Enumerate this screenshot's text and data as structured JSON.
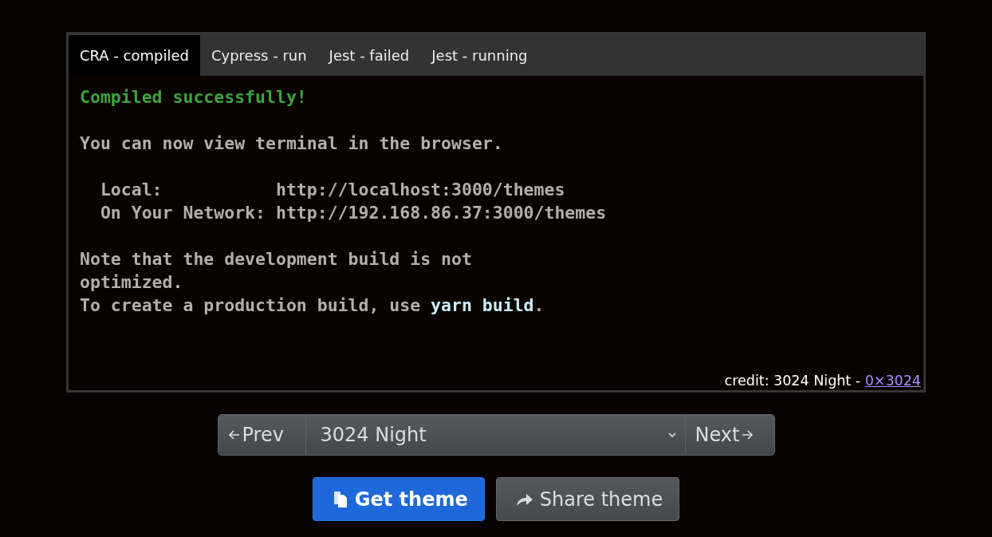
{
  "tabs": [
    {
      "label": "CRA - compiled",
      "selected": true
    },
    {
      "label": "Cypress - run",
      "selected": false
    },
    {
      "label": "Jest - failed",
      "selected": false
    },
    {
      "label": "Jest - running",
      "selected": false
    }
  ],
  "terminal": {
    "lines": [
      {
        "kind": "text",
        "segments": [
          {
            "text": "Compiled successfully!",
            "kind": "success"
          }
        ]
      },
      {
        "kind": "blank"
      },
      {
        "kind": "text",
        "segments": [
          {
            "text": "You can now view terminal in the browser.",
            "kind": "plain"
          }
        ]
      },
      {
        "kind": "blank"
      },
      {
        "kind": "text",
        "segments": [
          {
            "text": "  Local:           http://localhost:3000/themes",
            "kind": "plain"
          }
        ]
      },
      {
        "kind": "text",
        "segments": [
          {
            "text": "  On Your Network: http://192.168.86.37:3000/themes",
            "kind": "plain"
          }
        ]
      },
      {
        "kind": "blank"
      },
      {
        "kind": "text",
        "segments": [
          {
            "text": "Note that the development build is not",
            "kind": "plain"
          }
        ]
      },
      {
        "kind": "text",
        "segments": [
          {
            "text": "optimized.",
            "kind": "plain"
          }
        ]
      },
      {
        "kind": "text",
        "segments": [
          {
            "text": "To create a production build, use ",
            "kind": "plain"
          },
          {
            "text": "yarn build",
            "kind": "command"
          },
          {
            "text": ".",
            "kind": "plain"
          }
        ]
      }
    ]
  },
  "credit": {
    "text": "credit: 3024 Night - ",
    "link": "0×3024"
  },
  "theme_picker": {
    "prev": "Prev",
    "value": "3024 Night",
    "next": "Next"
  },
  "buttons": [
    {
      "label": "Get theme",
      "kind": "primary"
    },
    {
      "label": "Share theme",
      "kind": "secondary"
    }
  ]
}
